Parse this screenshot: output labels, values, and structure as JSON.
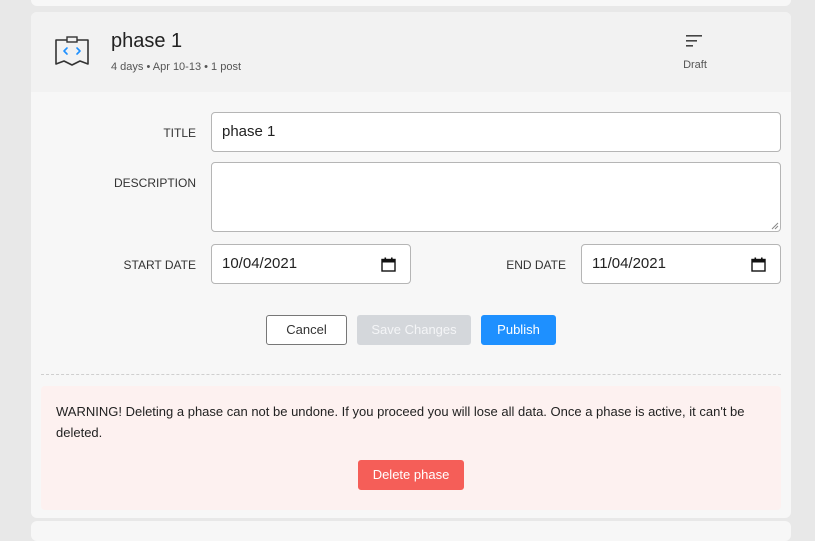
{
  "phase": {
    "title": "phase 1",
    "meta": "4 days • Apr 10-13 • 1 post",
    "status": "Draft"
  },
  "form": {
    "title_label": "TITLE",
    "title_value": "phase 1",
    "description_label": "DESCRIPTION",
    "description_value": "",
    "start_date_label": "START DATE",
    "start_date_value": "10/04/2021",
    "end_date_label": "END DATE",
    "end_date_value": "11/04/2021"
  },
  "actions": {
    "cancel": "Cancel",
    "save": "Save Changes",
    "publish": "Publish"
  },
  "warning": {
    "text": "WARNING! Deleting a phase can not be undone. If you proceed you will lose all data. Once a phase is active, it can't be deleted.",
    "delete_button": "Delete phase"
  },
  "icons": {
    "phase": "code-folder-icon",
    "status": "draft-lines-icon",
    "calendar": "calendar-icon"
  },
  "colors": {
    "primary": "#1e90ff",
    "danger": "#f55e58",
    "warning_bg": "#fdf1f0",
    "disabled": "#d4d7db"
  }
}
